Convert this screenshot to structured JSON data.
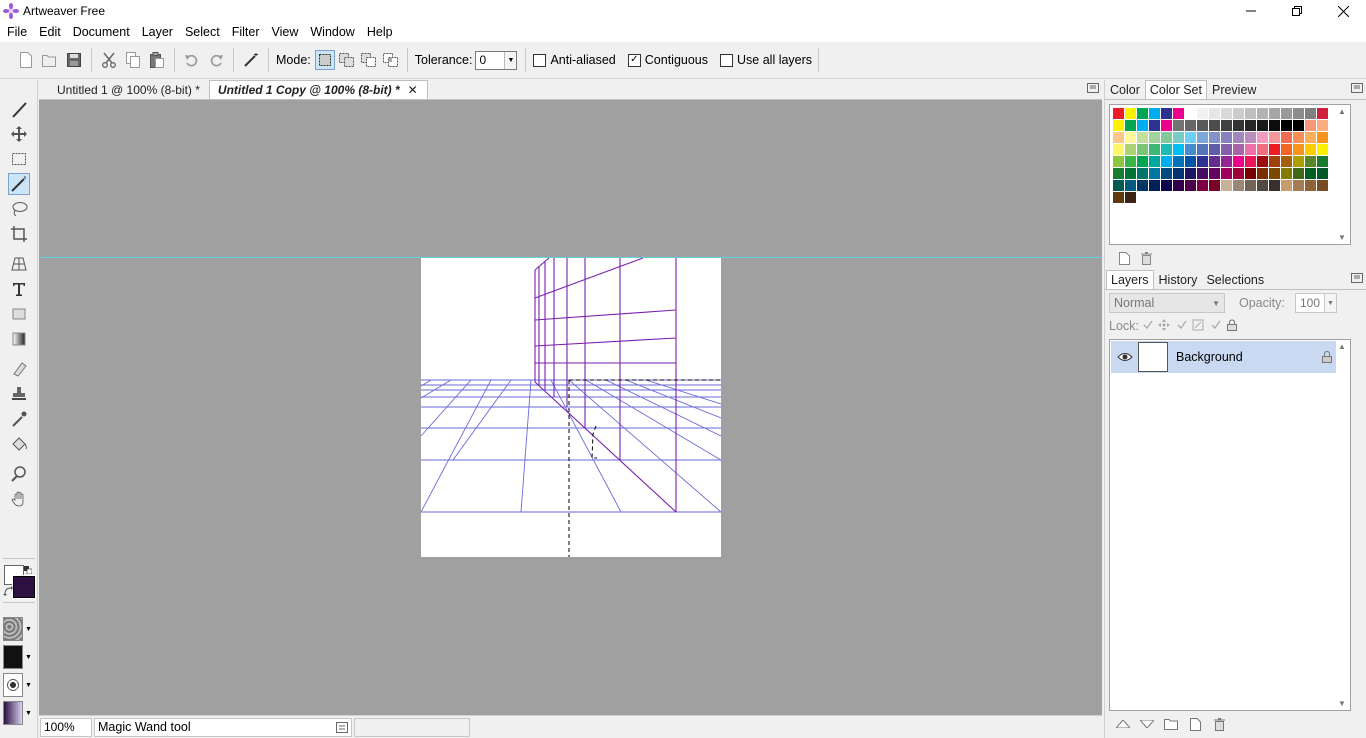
{
  "window": {
    "title": "Artweaver Free",
    "controls": {
      "minimize": "—",
      "restore": "❐",
      "close": "✕"
    }
  },
  "menu": [
    "File",
    "Edit",
    "Document",
    "Layer",
    "Select",
    "Filter",
    "View",
    "Window",
    "Help"
  ],
  "options_bar": {
    "mode_label": "Mode:",
    "tolerance_label": "Tolerance:",
    "tolerance_value": "0",
    "anti_aliased": {
      "label": "Anti-aliased",
      "checked": false
    },
    "contiguous": {
      "label": "Contiguous",
      "checked": true
    },
    "use_all_layers": {
      "label": "Use all layers",
      "checked": false
    }
  },
  "document_tabs": [
    {
      "label": "Untitled 1 @ 100% (8-bit) *",
      "active": false
    },
    {
      "label": "Untitled 1 Copy @ 100% (8-bit) *",
      "active": true,
      "close": "✕"
    }
  ],
  "colors": {
    "foreground": "#2b1040",
    "background": "#ffffff",
    "workspace": "#a0a0a0",
    "guide": "#5ed4e0",
    "grid_blue": "#6a6ad8",
    "grid_purple": "#7a1fb0"
  },
  "status": {
    "zoom": "100%",
    "tool_name": "Magic Wand tool"
  },
  "color_panel": {
    "tabs": [
      "Color",
      "Color Set",
      "Preview"
    ],
    "active_tab": "Color Set",
    "swatches": [
      "#ed1c24",
      "#fff200",
      "#00a651",
      "#00aeef",
      "#2e3192",
      "#ec008c",
      "#ffffff",
      "#f2f2f2",
      "#e6e6e6",
      "#d9d9d9",
      "#cccccc",
      "#bfbfbf",
      "#b3b3b3",
      "#a6a6a6",
      "#999999",
      "#8c8c8c",
      "#808080",
      "#d01f3c",
      "#fff200",
      "#00a651",
      "#00aeef",
      "#2e3192",
      "#ec008c",
      "#737373",
      "#666666",
      "#595959",
      "#4d4d4d",
      "#404040",
      "#333333",
      "#262626",
      "#1a1a1a",
      "#0d0d0d",
      "#000000",
      "#000000",
      "#f79679",
      "#f9ad81",
      "#fdc689",
      "#fff799",
      "#c4df9b",
      "#a3d39c",
      "#82ca9c",
      "#7accc8",
      "#6dcff6",
      "#7da7d9",
      "#8393ca",
      "#8781bd",
      "#a187be",
      "#bd8cbf",
      "#f49ac1",
      "#f5989d",
      "#f26c4f",
      "#f68e56",
      "#fbaf5d",
      "#f7941d",
      "#fff568",
      "#acd373",
      "#7cc576",
      "#3cb878",
      "#1cbbb4",
      "#00bff3",
      "#448ccb",
      "#5674b9",
      "#605ca8",
      "#8560a8",
      "#a864a8",
      "#f06eaa",
      "#f26d7d",
      "#ed1c24",
      "#f26522",
      "#f7941d",
      "#ffcc00",
      "#fff200",
      "#8dc63f",
      "#39b54a",
      "#00a651",
      "#00a99d",
      "#00aeef",
      "#0072bc",
      "#0054a6",
      "#2e3192",
      "#662d91",
      "#92278f",
      "#ec008c",
      "#ed145b",
      "#9e0b0f",
      "#a0410d",
      "#a36209",
      "#aba000",
      "#598527",
      "#1a7b30",
      "#197b30",
      "#007236",
      "#00746b",
      "#0076a3",
      "#004a80",
      "#003471",
      "#1b1464",
      "#440e62",
      "#630460",
      "#9e005d",
      "#9e0039",
      "#790000",
      "#7b2e00",
      "#7d4900",
      "#827b00",
      "#406618",
      "#005e20",
      "#005826",
      "#005952",
      "#005b7f",
      "#003663",
      "#002157",
      "#0d004c",
      "#32004b",
      "#4b0049",
      "#7b0046",
      "#7a0026",
      "#c7b299",
      "#998675",
      "#736357",
      "#534741",
      "#37302d",
      "#c69c6d",
      "#a67c52",
      "#8c6239",
      "#754c24",
      "#603913",
      "#3c2415"
    ]
  },
  "layers_panel": {
    "tabs": [
      "Layers",
      "History",
      "Selections"
    ],
    "active_tab": "Layers",
    "blend_mode": "Normal",
    "opacity_label": "Opacity:",
    "opacity_value": "100",
    "lock_label": "Lock:",
    "layers": [
      {
        "name": "Background",
        "visible": true,
        "locked": true
      }
    ]
  }
}
